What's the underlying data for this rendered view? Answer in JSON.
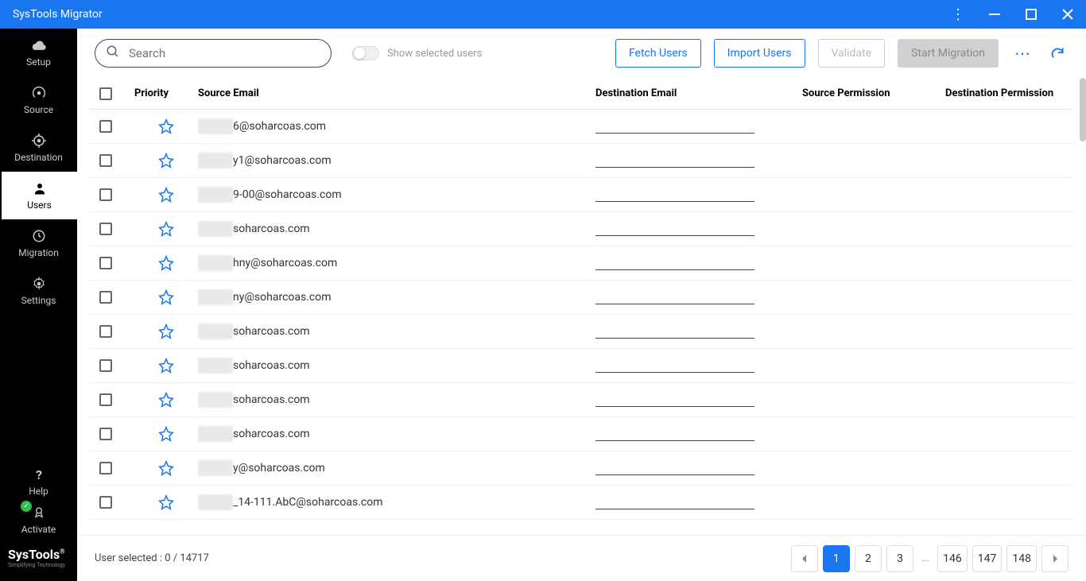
{
  "titlebar": {
    "title": "SysTools Migrator"
  },
  "sidebar": {
    "items": [
      {
        "key": "setup",
        "label": "Setup",
        "icon": "cloud"
      },
      {
        "key": "source",
        "label": "Source",
        "icon": "radar"
      },
      {
        "key": "destination",
        "label": "Destination",
        "icon": "target"
      },
      {
        "key": "users",
        "label": "Users",
        "icon": "user",
        "active": true
      },
      {
        "key": "migration",
        "label": "Migration",
        "icon": "clock"
      },
      {
        "key": "settings",
        "label": "Settings",
        "icon": "gear"
      }
    ],
    "help": "Help",
    "activate": "Activate"
  },
  "logo": {
    "main": "SysTools",
    "sub": "Simplifying Technology"
  },
  "toolbar": {
    "search_placeholder": "Search",
    "toggle_label": "Show selected users",
    "fetch": "Fetch Users",
    "import": "Import Users",
    "validate": "Validate",
    "start": "Start Migration"
  },
  "table": {
    "headers": {
      "priority": "Priority",
      "source": "Source Email",
      "dest": "Destination Email",
      "src_perm": "Source Permission",
      "dest_perm": "Destination Permission"
    },
    "rows": [
      {
        "source_suffix": "6@soharcoas.com"
      },
      {
        "source_suffix": "y1@soharcoas.com"
      },
      {
        "source_suffix": "9-00@soharcoas.com"
      },
      {
        "source_suffix": "soharcoas.com"
      },
      {
        "source_suffix": "hny@soharcoas.com"
      },
      {
        "source_suffix": "ny@soharcoas.com"
      },
      {
        "source_suffix": "soharcoas.com"
      },
      {
        "source_suffix": "soharcoas.com"
      },
      {
        "source_suffix": "soharcoas.com"
      },
      {
        "source_suffix": "soharcoas.com"
      },
      {
        "source_suffix": "y@soharcoas.com"
      },
      {
        "source_suffix": "_14-111.AbC@soharcoas.com"
      }
    ]
  },
  "footer": {
    "status": "User selected : 0 / 14717",
    "pages_left": [
      "1",
      "2",
      "3"
    ],
    "pages_right": [
      "146",
      "147",
      "148"
    ]
  }
}
